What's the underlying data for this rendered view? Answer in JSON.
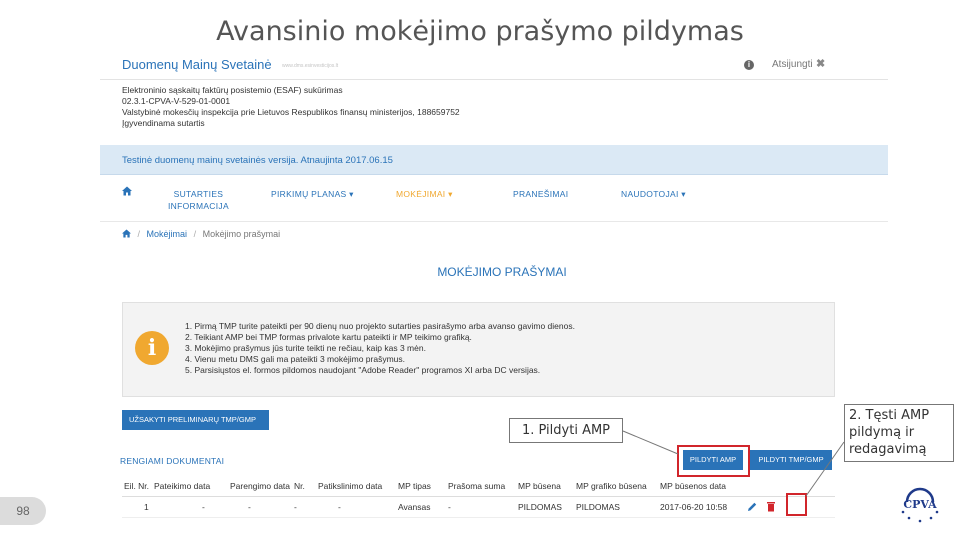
{
  "slide": {
    "title": "Avansinio mokėjimo prašymo pildymas",
    "page_number": "98"
  },
  "topbar": {
    "site_name": "Duomenų Mainų Svetainė",
    "site_sub": "www.dms.esinvesticijos.lt",
    "logout": "Atsijungti",
    "logout_icon": "close-icon"
  },
  "contract": {
    "lines": [
      "Elektroninio sąskaitų faktūrų posistemio (ESAF) sukūrimas",
      "02.3.1-CPVA-V-529-01-0001",
      "Valstybinė mokesčių inspekcija prie Lietuvos Respublikos finansų ministerijos, 188659752",
      "Įgyvendinama sutartis"
    ]
  },
  "banner": {
    "text": "Testinė duomenų mainų svetainės versija. Atnaujinta 2017.06.15"
  },
  "nav": {
    "home_icon": "home-icon",
    "items": [
      {
        "label": "SUTARTIES",
        "label2": "INFORMACIJA"
      },
      {
        "label": "PIRKIMŲ PLANAS ▾"
      },
      {
        "label": "MOKĖJIMAI ▾"
      },
      {
        "label": "PRANEŠIMAI"
      },
      {
        "label": "NAUDOTOJAI ▾"
      }
    ]
  },
  "breadcrumb": {
    "sep": "/",
    "item1": "Mokėjimai",
    "item2": "Mokėjimo prašymai"
  },
  "main": {
    "heading": "MOKĖJIMO PRAŠYMAI",
    "notice_icon": "info-icon",
    "notice_icon_glyph": "i",
    "notice": [
      "1.  Pirmą TMP turite pateikti per 90 dienų nuo projekto sutarties pasirašymo arba avanso gavimo dienos.",
      "2.  Teikiant AMP bei TMP formas privalote kartu pateikti ir MP teikimo grafiką.",
      "3.  Mokėjimo prašymus jūs turite teikti ne rečiau, kaip kas 3 mėn.",
      "4.  Vienu metu DMS gali ma pateikti 3 mokėjimo prašymus.",
      "5.  Parsisiųstos el. formos pildomos naudojant \"Adobe Reader\" programos XI arba DC versijas."
    ],
    "order_button": "UŽSAKYTI PRELIMINARŲ TMP/GMP",
    "docs_label": "RENGIAMI DOKUMENTAI",
    "btn_amp": "PILDYTI AMP",
    "btn_tmp": "PILDYTI TMP/GMP"
  },
  "table": {
    "headers": [
      "Eil. Nr.",
      "Pateikimo data",
      "Parengimo data",
      "Nr.",
      "Patikslinimo data",
      "MP tipas",
      "Prašoma suma",
      "MP būsena",
      "MP grafiko būsena",
      "MP būsenos data",
      ""
    ],
    "rows": [
      [
        "1",
        "-",
        "-",
        "-",
        "-",
        "Avansas",
        "-",
        "PILDOMAS",
        "PILDOMAS",
        "2017-06-20 10:58"
      ]
    ],
    "row_actions": [
      "edit-icon",
      "delete-icon"
    ]
  },
  "annotations": {
    "callout1": "1. Pildyti AMP",
    "callout2": "2. Tęsti AMP pildymą ir redagavimą",
    "highlight_color": "#d1252b"
  },
  "logo": {
    "text": "CPVA"
  },
  "colors": {
    "primary": "#2a73b8",
    "accent": "#f0a830",
    "banner_bg": "#dbe9f5"
  }
}
